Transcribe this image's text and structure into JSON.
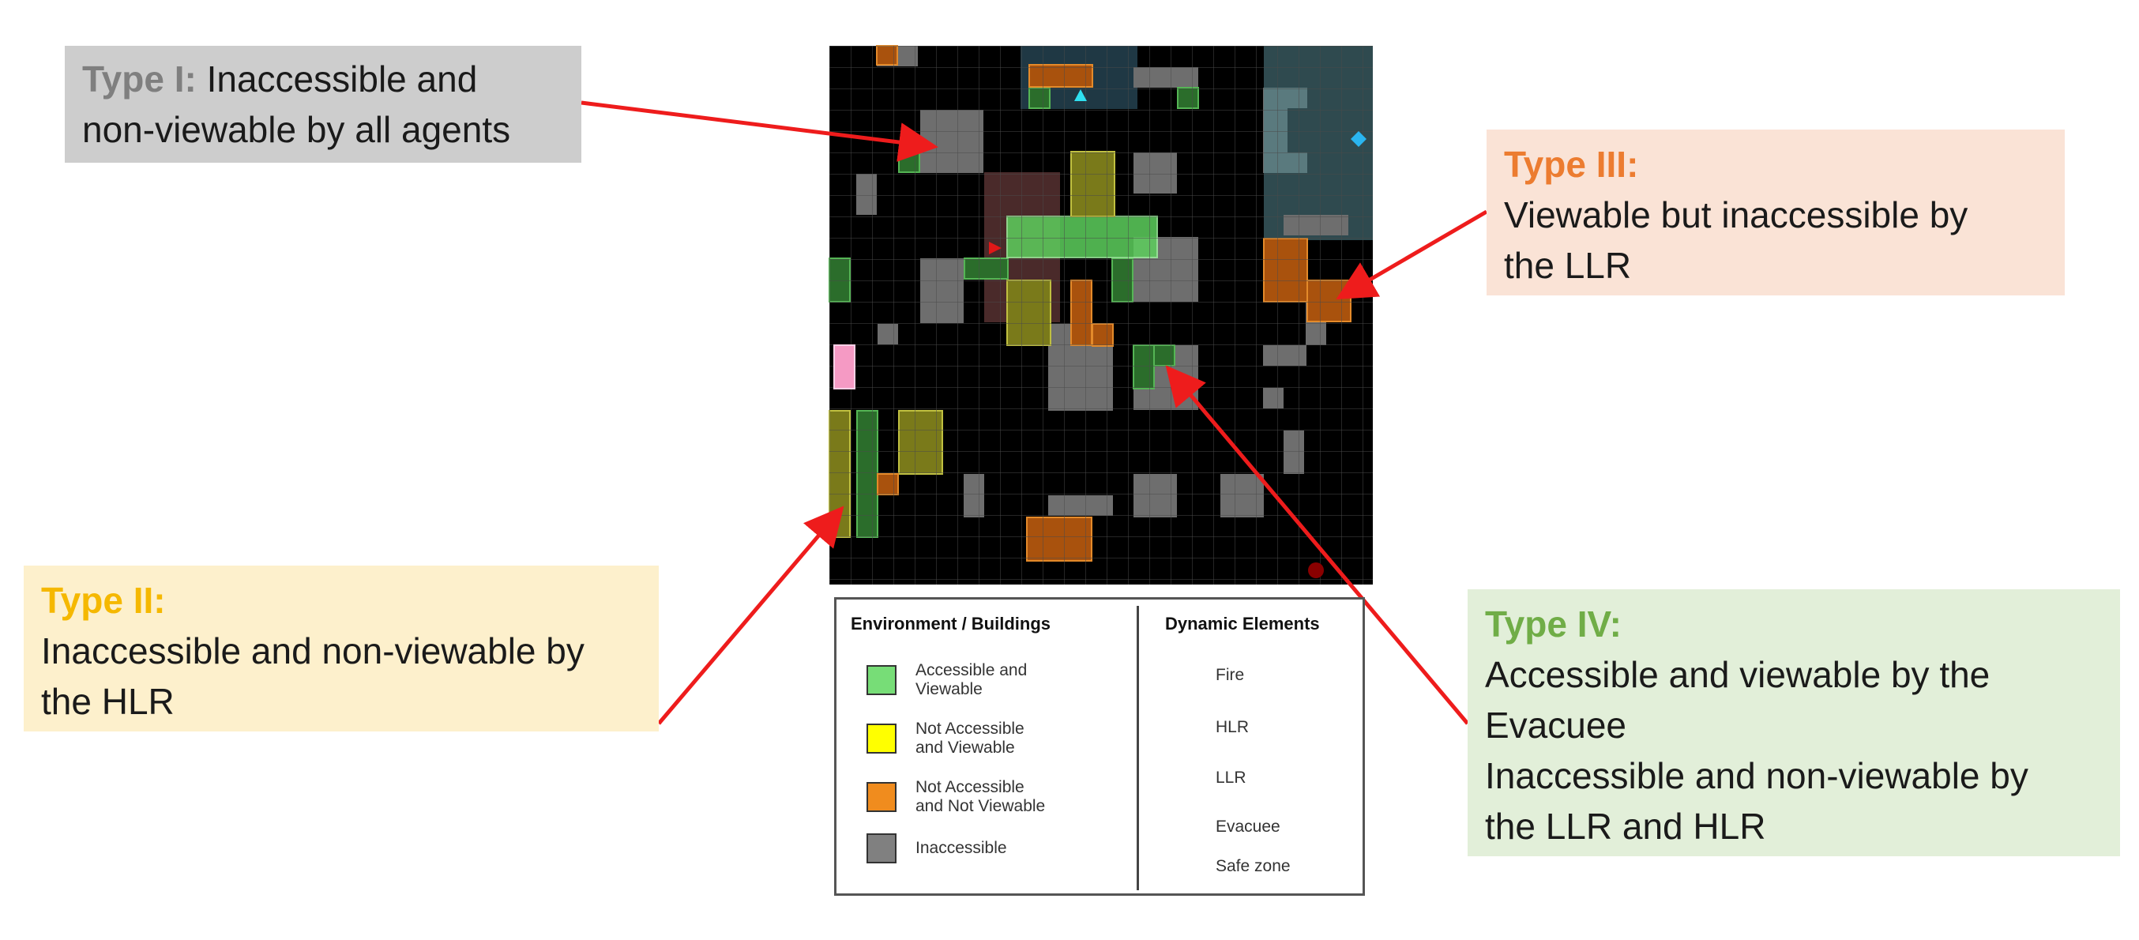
{
  "callouts": {
    "type1": {
      "head": "Type I:",
      "line1_rest": "Inaccessible and",
      "line2": "non-viewable by all agents",
      "bg": "#cdcdcd",
      "head_color": "#7f7f7f"
    },
    "type2": {
      "head": "Type II:",
      "line2": "Inaccessible and non-viewable by",
      "line3": "the HLR",
      "bg": "#fdf0cc",
      "head_color": "#f5b800"
    },
    "type3": {
      "head": "Type III:",
      "line2": "Viewable but inaccessible by",
      "line3": "the LLR",
      "bg": "#fae3d6",
      "head_color": "#ec7c30"
    },
    "type4": {
      "head": "Type IV:",
      "line2": "Accessible and viewable by the",
      "line3": "Evacuee",
      "line4": "Inaccessible and non-viewable by",
      "line5": "the LLR and HLR",
      "bg": "#e2efd9",
      "head_color": "#70ad47"
    }
  },
  "legend": {
    "env_title": "Environment / Buildings",
    "dyn_title": "Dynamic Elements",
    "env_items": [
      {
        "line1": "Accessible and",
        "line2": "Viewable",
        "color": "#77dd77"
      },
      {
        "line1": "Not Accessible",
        "line2": "and Viewable",
        "color": "#ffff00"
      },
      {
        "line1": "Not Accessible",
        "line2": "and Not  Viewable",
        "color": "#f08c1e"
      },
      {
        "line1": "Inaccessible",
        "line2": "",
        "color": "#808080"
      }
    ],
    "dyn_items": [
      {
        "label": "Fire",
        "icon": "square",
        "color": "#f59ac4"
      },
      {
        "label": "HLR",
        "icon": "diamond",
        "color": "#2ab5b5"
      },
      {
        "label": "LLR",
        "icon": "triangle-up",
        "color": "#2fe0f0"
      },
      {
        "label": "Evacuee",
        "icon": "triangle-right",
        "color": "#e01818"
      },
      {
        "label": "Safe zone",
        "icon": "circle",
        "color": "#c00000"
      }
    ]
  },
  "colors": {
    "arrow": "#ee1c1c",
    "grid_background": "#000000",
    "accessible_viewable": "#2b6d2b",
    "not_accessible_viewable": "#8a8a1e",
    "not_accessible_not_viewable": "#b05a10",
    "inaccessible": "#6e6e6e"
  }
}
